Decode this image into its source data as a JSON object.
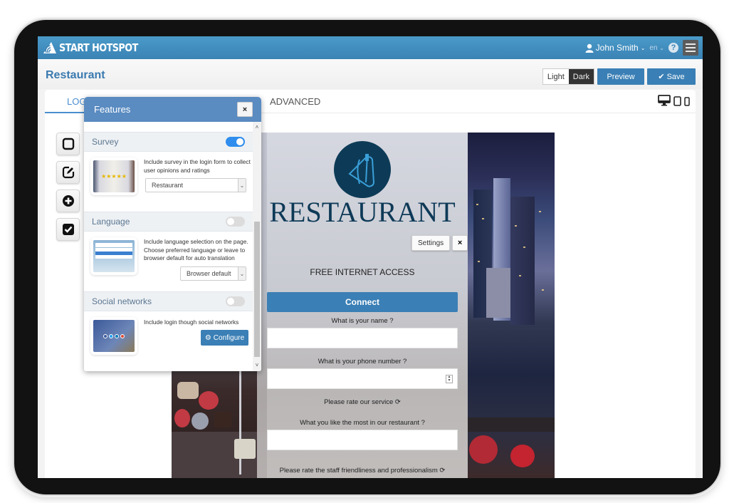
{
  "app": {
    "brand": "START HOTSPOT",
    "user_name": "John Smith",
    "language": "en",
    "help_icon": "question-circle-icon",
    "menu_icon": "hamburger-icon"
  },
  "header": {
    "page_title": "Restaurant",
    "theme_light": "Light",
    "theme_dark": "Dark",
    "preview_label": "Preview",
    "save_label": "Save"
  },
  "tabs": [
    {
      "label": "LOGIN",
      "visible_text": "LOG",
      "active": true
    },
    {
      "label": "ADVANCED",
      "active": false
    }
  ],
  "devices": [
    "desktop-icon",
    "tablet-icon",
    "mobile-icon"
  ],
  "tools": [
    "square-icon",
    "edit-icon",
    "plus-circle-icon",
    "checkbox-icon"
  ],
  "features": {
    "title": "Features",
    "close": "×",
    "sections": [
      {
        "title": "Survey",
        "enabled": true,
        "description": "Include survey in the login form to collect user opinions and ratings",
        "select_value": "Restaurant"
      },
      {
        "title": "Language",
        "enabled": false,
        "description": "Include language selection on the page. Choose preferred language or leave to browser default for auto translation",
        "select_value": "Browser default"
      },
      {
        "title": "Social networks",
        "enabled": false,
        "description": "Include login though social networks",
        "button_label": "Configure"
      }
    ]
  },
  "preview": {
    "logo_word": "RESTAURANT",
    "settings_label": "Settings",
    "settings_close": "×",
    "headline": "FREE INTERNET ACCESS",
    "connect_label": "Connect",
    "questions": [
      {
        "label": "What is your name ?",
        "type": "text",
        "value": ""
      },
      {
        "label": "What is your phone number ?",
        "type": "number",
        "value": ""
      },
      {
        "label": "Please rate our service",
        "type": "rating"
      },
      {
        "label": "What you like the most in our restaurant ?",
        "type": "text",
        "value": ""
      },
      {
        "label": "Please rate the staff friendliness and professionalism",
        "type": "rating"
      }
    ]
  },
  "colors": {
    "topbar": "#3a82b5",
    "accent": "#3a7fb5",
    "title": "#3a7ab0",
    "features_header": "#5a8bc1",
    "toggle_on": "#2e8ded",
    "logo_navy": "#0e3a57"
  }
}
